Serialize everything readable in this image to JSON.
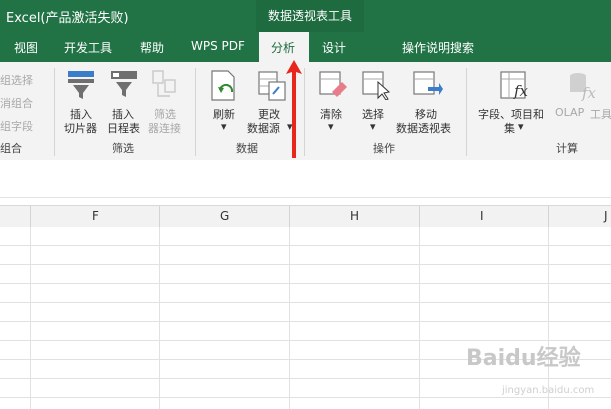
{
  "window": {
    "title": "Excel(产品激活失败)",
    "context_tab_group": "数据透视表工具"
  },
  "tabs": [
    "视图",
    "开发工具",
    "帮助",
    "WPS PDF",
    "分析",
    "设计",
    "操作说明搜索"
  ],
  "active_tab": "分析",
  "ribbon": {
    "group_partial": {
      "items": [
        "组选择",
        "消组合",
        "组字段"
      ],
      "label": "组合"
    },
    "filter": {
      "label": "筛选",
      "insert_slicer": [
        "插入",
        "切片器"
      ],
      "insert_timeline": [
        "插入",
        "日程表"
      ],
      "filter_connections": [
        "筛选",
        "器连接"
      ]
    },
    "data": {
      "label": "数据",
      "refresh": "刷新",
      "change_source": [
        "更改",
        "数据源"
      ]
    },
    "actions": {
      "label": "操作",
      "clear": "清除",
      "select": "选择",
      "move": [
        "移动",
        "数据透视表"
      ]
    },
    "calc": {
      "label": "计算",
      "fields_items": [
        "字段、项目和",
        "集"
      ],
      "olap": [
        "OLAP",
        "工具"
      ]
    }
  },
  "columns": [
    "F",
    "G",
    "H",
    "I",
    "J"
  ],
  "watermark": {
    "brand": "Baidu",
    "brand_suffix": "经验",
    "url": "jingyan.baidu.com"
  },
  "colors": {
    "excel_green": "#217346",
    "annotation_red": "#e8261c"
  }
}
